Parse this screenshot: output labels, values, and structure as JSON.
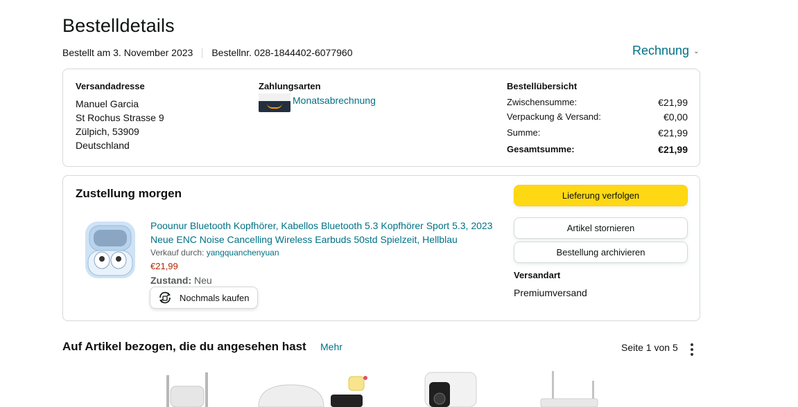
{
  "page": {
    "title": "Bestelldetails",
    "ordered_on": "Bestellt am 3. November 2023",
    "order_number": "Bestellnr. 028-1844402-6077960",
    "invoice_label": "Rechnung"
  },
  "summary": {
    "shipping_address": {
      "heading": "Versandadresse",
      "name": "Manuel Garcia",
      "street": "St Rochus Strasse 9",
      "city": "Zülpich, 53909",
      "country": "Deutschland"
    },
    "payment": {
      "heading": "Zahlungsarten",
      "method": "Monatsabrechnung"
    },
    "overview": {
      "heading": "Bestellübersicht",
      "rows": [
        {
          "label": "Zwischensumme:",
          "value": "€21,99"
        },
        {
          "label": "Verpackung & Versand:",
          "value": "€0,00"
        },
        {
          "label": "Summe:",
          "value": "€21,99"
        },
        {
          "label": "Gesamtsumme:",
          "value": "€21,99"
        }
      ]
    }
  },
  "delivery": {
    "status": "Zustellung morgen",
    "product_title": "Poounur Bluetooth Kopfhörer, Kabellos Bluetooth 5.3 Kopfhörer Sport 5.3, 2023 Neue ENC Noise Cancelling Wireless Earbuds 50std Spielzeit, Hellblau",
    "sold_by_label": "Verkauf durch:",
    "seller": "yangquanchenyuan",
    "price": "€21,99",
    "condition_label": "Zustand:",
    "condition_value": "Neu",
    "buy_again": "Nochmals kaufen",
    "track_button": "Lieferung verfolgen",
    "cancel_button": "Artikel stornieren",
    "archive_button": "Bestellung archivieren",
    "shipping_type_heading": "Versandart",
    "shipping_type_value": "Premiumversand"
  },
  "recommendations": {
    "title": "Auf Artikel bezogen, die du angesehen hast",
    "more": "Mehr",
    "pager": "Seite 1 von 5"
  },
  "colors": {
    "link": "#007185",
    "price": "#b12704",
    "primary_button": "#ffd814",
    "border": "#d5d9d9"
  }
}
